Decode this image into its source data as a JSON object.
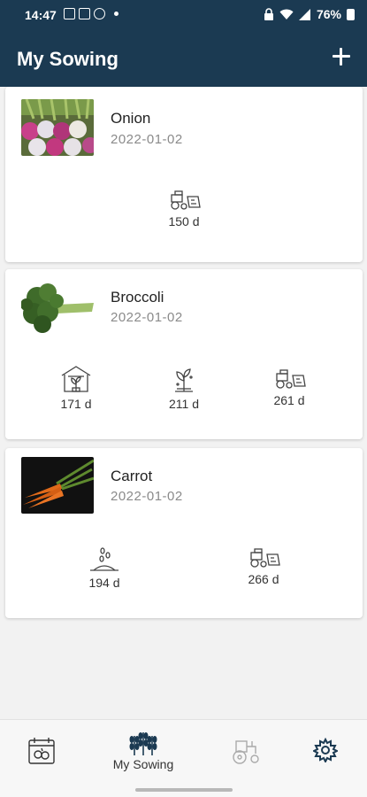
{
  "status_bar": {
    "time": "14:47",
    "battery": "76%"
  },
  "app_bar": {
    "title": "My Sowing"
  },
  "cards": [
    {
      "name": "Onion",
      "date": "2022-01-02",
      "stages": [
        {
          "icon": "tractor-harvest-icon",
          "label": "150 d"
        }
      ]
    },
    {
      "name": "Broccoli",
      "date": "2022-01-02",
      "stages": [
        {
          "icon": "greenhouse-icon",
          "label": "171 d"
        },
        {
          "icon": "seedling-icon",
          "label": "211 d"
        },
        {
          "icon": "tractor-harvest-icon",
          "label": "261 d"
        }
      ]
    },
    {
      "name": "Carrot",
      "date": "2022-01-02",
      "stages": [
        {
          "icon": "seeds-sowing-icon",
          "label": "194 d"
        },
        {
          "icon": "tractor-harvest-icon",
          "label": "266 d"
        }
      ]
    }
  ],
  "bottom_nav": {
    "active_label": "My Sowing",
    "accent": "#1b3a52"
  }
}
